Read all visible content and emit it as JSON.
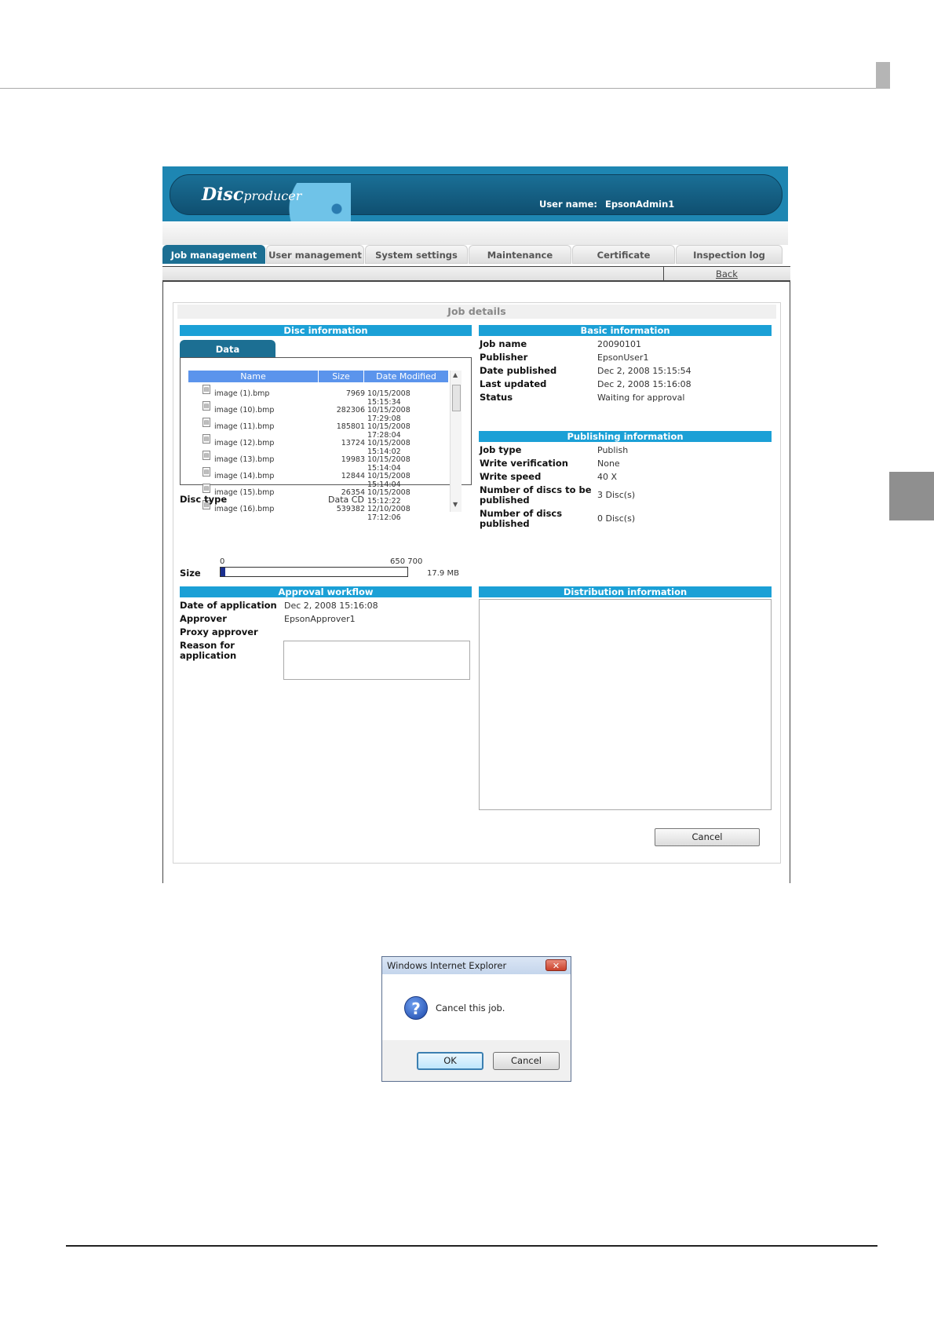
{
  "app": {
    "logo_main": "Disc",
    "logo_sub": "producer",
    "user_label": "User name:",
    "user_value": "EpsonAdmin1"
  },
  "tabs": [
    "Job management",
    "User management",
    "System settings",
    "Maintenance",
    "Certificate",
    "Inspection log"
  ],
  "back_label": "Back",
  "job_details_title": "Job details",
  "disc": {
    "header": "Disc information",
    "data_tab": "Data",
    "columns": [
      "Name",
      "Size",
      "Date Modified"
    ],
    "files": [
      {
        "name": "image (1).bmp",
        "size": "7969",
        "date": "10/15/2008 15:15:34"
      },
      {
        "name": "image (10).bmp",
        "size": "282306",
        "date": "10/15/2008 17:29:08"
      },
      {
        "name": "image (11).bmp",
        "size": "185801",
        "date": "10/15/2008 17:28:04"
      },
      {
        "name": "image (12).bmp",
        "size": "13724",
        "date": "10/15/2008 15:14:02"
      },
      {
        "name": "image (13).bmp",
        "size": "19983",
        "date": "10/15/2008 15:14:04"
      },
      {
        "name": "image (14).bmp",
        "size": "12844",
        "date": "10/15/2008 15:14:04"
      },
      {
        "name": "image (15).bmp",
        "size": "26354",
        "date": "10/15/2008 15:12:22"
      },
      {
        "name": "image (16).bmp",
        "size": "539382",
        "date": "12/10/2008 17:12:06"
      }
    ],
    "disc_type_label": "Disc type",
    "disc_type_value": "Data CD",
    "size_label": "Size",
    "size_min": "0",
    "size_ticks": "650 700",
    "size_value": "17.9 MB",
    "size_fill_fraction": 0.026
  },
  "basic": {
    "header": "Basic information",
    "rows": [
      {
        "label": "Job name",
        "value": "20090101"
      },
      {
        "label": "Publisher",
        "value": "EpsonUser1"
      },
      {
        "label": "Date published",
        "value": "Dec 2, 2008 15:15:54"
      },
      {
        "label": "Last updated",
        "value": "Dec 2, 2008 15:16:08"
      },
      {
        "label": "Status",
        "value": "Waiting for approval"
      }
    ]
  },
  "publishing": {
    "header": "Publishing information",
    "rows": [
      {
        "label": "Job type",
        "value": "Publish"
      },
      {
        "label": "Write verification",
        "value": "None"
      },
      {
        "label": "Write speed",
        "value": "40 X"
      },
      {
        "label": "Number of discs to be published",
        "value": "3 Disc(s)"
      },
      {
        "label": "Number of discs published",
        "value": "0 Disc(s)"
      }
    ]
  },
  "approval": {
    "header": "Approval workflow",
    "rows": [
      {
        "label": "Date of application",
        "value": "Dec 2, 2008 15:16:08"
      },
      {
        "label": "Approver",
        "value": "EpsonApprover1"
      },
      {
        "label": "Proxy approver",
        "value": ""
      },
      {
        "label": "Reason for application",
        "value": ""
      }
    ]
  },
  "distribution": {
    "header": "Distribution information"
  },
  "cancel_label": "Cancel",
  "dialog": {
    "title": "Windows Internet Explorer",
    "close": "✕",
    "icon": "?",
    "message": "Cancel this job.",
    "ok": "OK",
    "cancel": "Cancel"
  }
}
